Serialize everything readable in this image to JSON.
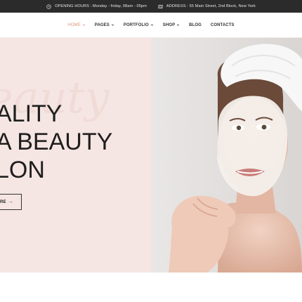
{
  "topbar": {
    "hours_text": "OPENING HOURS : Monday - friday, 08am - 05pm",
    "address_text": "ADDRESS : 55 Main Street, 2nd Block, New York"
  },
  "nav": {
    "items": [
      {
        "label": "HOME",
        "dropdown": true,
        "active": true
      },
      {
        "label": "PAGES",
        "dropdown": true
      },
      {
        "label": "PORTFOLIO",
        "dropdown": true
      },
      {
        "label": "SHOP",
        "dropdown": true
      },
      {
        "label": "BLOG",
        "dropdown": false
      },
      {
        "label": "CONTACTS",
        "dropdown": false
      }
    ]
  },
  "hero": {
    "script_word": "eauty",
    "headline": [
      "ALITY",
      "A BEAUTY",
      "LON"
    ],
    "cta_label": "RE",
    "cta_arrow": "→",
    "image_alt": "Woman with towel on head and white face mask"
  },
  "colors": {
    "topbar_bg": "#2b2b2b",
    "accent": "#d99679",
    "hero_left_bg": "#f6e6e3"
  },
  "icons": {
    "hours": "clock-icon",
    "address": "map-icon",
    "nav_dropdown": "chevron-down-icon",
    "cta": "arrow-right-icon"
  }
}
